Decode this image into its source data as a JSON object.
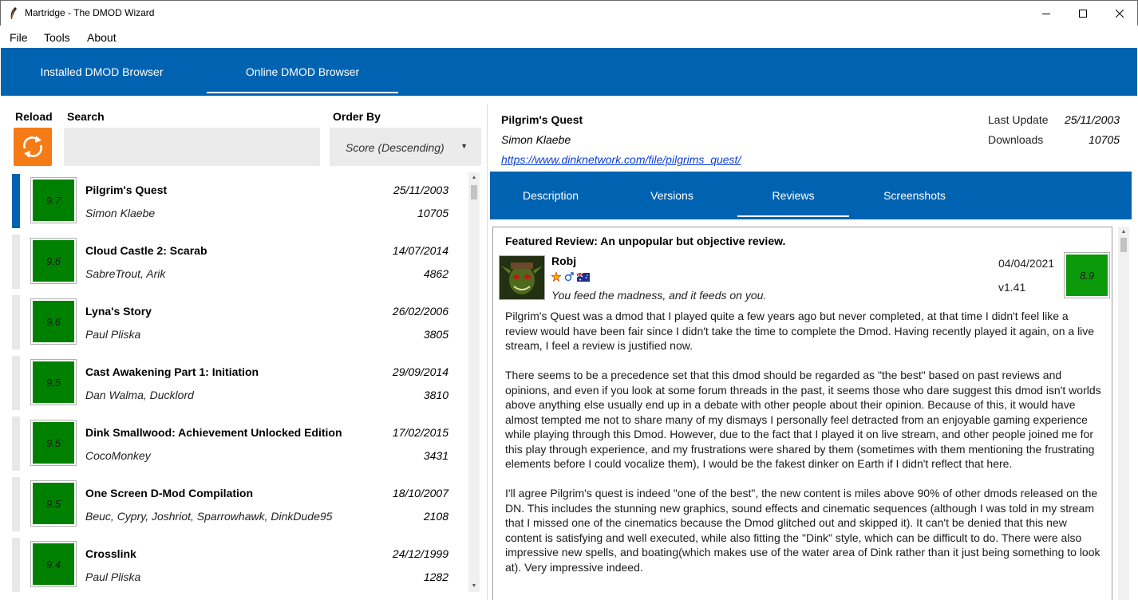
{
  "window": {
    "title": "Martridge - The DMOD Wizard",
    "controls": [
      "minimize-icon",
      "maximize-icon",
      "close-icon"
    ]
  },
  "menu": [
    "File",
    "Tools",
    "About"
  ],
  "main_tabs": [
    {
      "label": "Installed DMOD Browser",
      "active": false
    },
    {
      "label": "Online DMOD Browser",
      "active": true
    }
  ],
  "browser": {
    "reload_label": "Reload",
    "search_label": "Search",
    "search_value": "",
    "order_label": "Order By",
    "order_value": "Score (Descending)",
    "items": [
      {
        "score": "9.7",
        "name": "Pilgrim's Quest",
        "author": "Simon Klaebe",
        "date": "25/11/2003",
        "downloads": "10705",
        "selected": true
      },
      {
        "score": "9.6",
        "name": "Cloud Castle 2: Scarab",
        "author": "SabreTrout, Arik",
        "date": "14/07/2014",
        "downloads": "4862"
      },
      {
        "score": "9.6",
        "name": "Lyna's Story",
        "author": "Paul Pliska",
        "date": "26/02/2006",
        "downloads": "3805"
      },
      {
        "score": "9.5",
        "name": "Cast Awakening Part 1: Initiation",
        "author": "Dan Walma, Ducklord",
        "date": "29/09/2014",
        "downloads": "3810"
      },
      {
        "score": "9.5",
        "name": "Dink Smallwood: Achievement Unlocked Edition",
        "author": "CocoMonkey",
        "date": "17/02/2015",
        "downloads": "3431"
      },
      {
        "score": "9.5",
        "name": "One Screen D-Mod Compilation",
        "author": "Beuc, Cypry, Joshriot, Sparrowhawk, DinkDude95",
        "date": "18/10/2007",
        "downloads": "2108"
      },
      {
        "score": "9.4",
        "name": "Crosslink",
        "author": "Paul Pliska",
        "date": "24/12/1999",
        "downloads": "1282"
      }
    ]
  },
  "detail": {
    "title": "Pilgrim's Quest",
    "author": "Simon Klaebe",
    "url": "https://www.dinknetwork.com/file/pilgrims_quest/",
    "last_update_label": "Last Update",
    "last_update": "25/11/2003",
    "downloads_label": "Downloads",
    "downloads": "10705",
    "tabs": [
      {
        "label": "Description",
        "active": false
      },
      {
        "label": "Versions",
        "active": false
      },
      {
        "label": "Reviews",
        "active": true
      },
      {
        "label": "Screenshots",
        "active": false
      }
    ],
    "review": {
      "heading": "Featured Review: An unpopular but objective review.",
      "reviewer": "Robj",
      "tagline": "You feed the madness, and it feeds on you.",
      "date": "04/04/2021",
      "version": "v1.41",
      "score": "8.9",
      "paragraphs": [
        "Pilgrim's Quest was a dmod that I played quite a few years ago but never completed, at that time I didn't feel like a review would have been fair since I didn't take the time to complete the Dmod. Having recently played it again, on a live stream, I feel a review is justified now.",
        "There seems to be a precedence set that this dmod should be regarded as \"the best\" based on past reviews and opinions, and even if you look at some forum threads in the past, it seems those who dare suggest this dmod isn't worlds above anything else usually end up in a debate with other people about their opinion. Because of this, it would have almost tempted me not to share many of my dismays I personally feel detracted from an enjoyable gaming experience while playing through this Dmod. However, due to the fact that I played it on live stream, and other people joined me for this play through experience, and my frustrations were shared by them (sometimes with them mentioning the frustrating elements before I could vocalize them), I would be the fakest dinker on Earth if I didn't reflect that here.",
        "I'll agree Pilgrim's quest is indeed \"one of the best\", the new content is miles above 90% of other dmods released on the DN. This includes the stunning new graphics, sound effects and cinematic sequences (although I was told in my stream that I missed one of the cinematics because the Dmod glitched out and skipped it). It can't be denied that this new content is satisfying and well executed, while also fitting the \"Dink\" style, which can be difficult to do. There were also impressive new spells, and boating(which makes use of the water area of Dink rather than it just being something to look at). Very impressive indeed."
      ]
    }
  },
  "colors": {
    "accent": "#0063b1",
    "score_green": "#008000",
    "reload_orange": "#f47b16",
    "link": "#0b3ed6"
  }
}
